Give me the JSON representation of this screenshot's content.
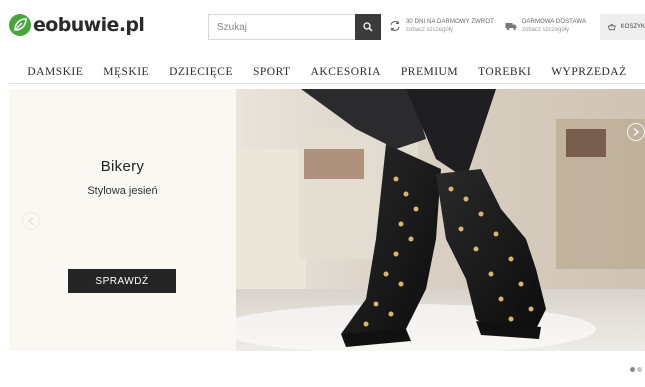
{
  "header": {
    "logo_text": "eobuwie.pl",
    "search": {
      "placeholder": "Szukaj"
    },
    "returns": {
      "title": "30 DNI NA DARMOWY ZWROT",
      "link": "zobacz szczegóły"
    },
    "delivery": {
      "title": "DARMOWA DOSTAWA",
      "link": "zobacz szczegóły"
    },
    "cart_label": "KOSZYK"
  },
  "nav": {
    "items": [
      "DAMSKIE",
      "MĘSKIE",
      "DZIECIĘCE",
      "SPORT",
      "AKCESORIA",
      "PREMIUM",
      "TOREBKI",
      "WYPRZEDAŻ"
    ]
  },
  "hero": {
    "title": "Bikery",
    "subtitle": "Stylowa jesień",
    "cta_label": "SPRAWDŹ"
  },
  "colors": {
    "brand_green": "#45a63b",
    "dark": "#252525",
    "hero_panel": "#faf8f3"
  },
  "icons": [
    "logo-leaf-icon",
    "search-icon",
    "return-arrows-icon",
    "delivery-truck-icon",
    "cart-basket-icon",
    "chevron-left-icon",
    "chevron-right-icon"
  ]
}
